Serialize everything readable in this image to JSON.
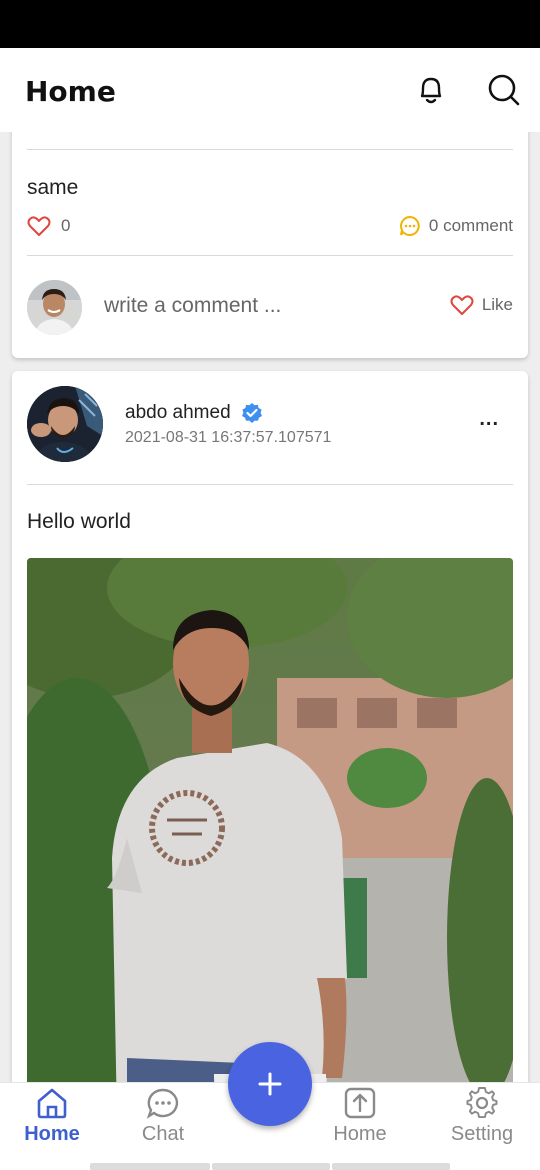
{
  "app_bar": {
    "title": "Home"
  },
  "feed": {
    "previous_post": {
      "text": "same",
      "like_count": "0",
      "comment_count": "0 comment",
      "comment_placeholder": "write a comment ...",
      "like_label": "Like"
    },
    "post": {
      "author": "abdo ahmed",
      "verified": true,
      "timestamp": "2021-08-31 16:37:57.107571",
      "text": "Hello world",
      "more_label": "..."
    }
  },
  "bottom_nav": {
    "items": [
      {
        "label": "Home",
        "icon": "home-icon",
        "active": true
      },
      {
        "label": "Chat",
        "icon": "chat-icon",
        "active": false
      },
      {
        "label": "Home",
        "icon": "upload-icon",
        "active": false
      },
      {
        "label": "Setting",
        "icon": "gear-icon",
        "active": false
      }
    ],
    "fab_icon": "plus-icon"
  },
  "colors": {
    "accent": "#4a63e0",
    "nav_active": "#3f5fce",
    "heart": "#e0463c",
    "comment_icon": "#f0b400",
    "verified": "#3d8ff0"
  }
}
